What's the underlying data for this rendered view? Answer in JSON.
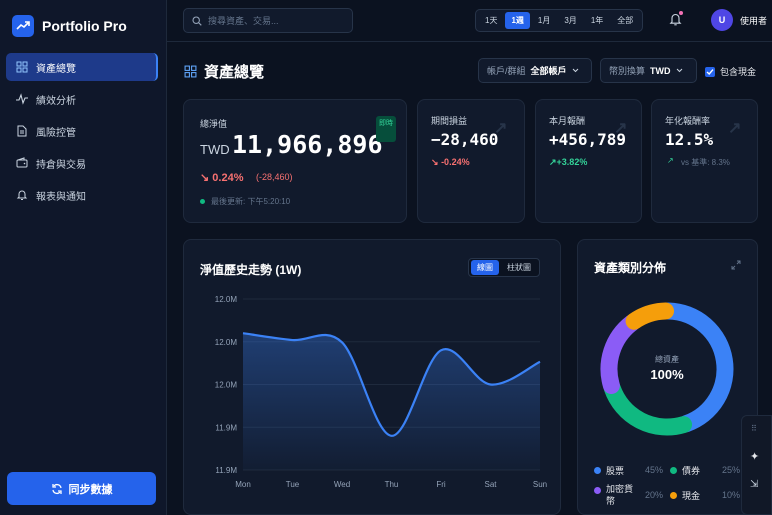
{
  "app": {
    "name": "Portfolio Pro"
  },
  "sidebar": {
    "items": [
      {
        "label": "資產總覽"
      },
      {
        "label": "績效分析"
      },
      {
        "label": "風險控管"
      },
      {
        "label": "持倉與交易"
      },
      {
        "label": "報表與通知"
      }
    ],
    "sync_label": "同步數據"
  },
  "topbar": {
    "search_placeholder": "搜尋資產、交易...",
    "ranges": [
      "1天",
      "1週",
      "1月",
      "3月",
      "1年",
      "全部"
    ],
    "active_range": "1週",
    "user_initial": "U",
    "user_name": "使用者"
  },
  "page": {
    "title": "資產總覽",
    "account_filter": {
      "label": "帳戶/群組",
      "value": "全部帳戶"
    },
    "currency_filter": {
      "label": "幣別換算",
      "value": "TWD"
    },
    "include_cash_label": "包含現金",
    "include_cash": true
  },
  "summary": {
    "label": "總淨值",
    "currency": "TWD",
    "value": "11,966,896",
    "badge": "即時",
    "change_pct": "0.24%",
    "change_abs": "(-28,460)",
    "updated": "最後更新: 下午5:20:10"
  },
  "kpis": [
    {
      "label": "期間損益",
      "value": "−28,460",
      "sub": "-0.24%",
      "sub_icon": "↘"
    },
    {
      "label": "本月報酬",
      "value": "+456,789",
      "sub": "+3.82%",
      "sub_icon": "↗"
    },
    {
      "label": "年化報酬率",
      "value": "12.5%",
      "sub": "vs 基準: 8.3%",
      "sub_icon": "↗"
    }
  ],
  "history": {
    "title": "淨值歷史走勢 (1W)",
    "toggle": [
      "線圖",
      "柱狀圖"
    ],
    "active_toggle": "線圖"
  },
  "allocation": {
    "title": "資產類別分佈",
    "center_label": "總資產",
    "center_value": "100%",
    "items": [
      {
        "name": "股票",
        "pct": "45%",
        "color": "#3b82f6"
      },
      {
        "name": "債券",
        "pct": "25%",
        "color": "#10b981"
      },
      {
        "name": "加密貨幣",
        "pct": "20%",
        "color": "#8b5cf6"
      },
      {
        "name": "現金",
        "pct": "10%",
        "color": "#f59e0b"
      }
    ]
  },
  "chart_data": [
    {
      "type": "area",
      "title": "淨值歷史走勢 (1W)",
      "categories": [
        "Mon",
        "Tue",
        "Wed",
        "Thu",
        "Fri",
        "Sat",
        "Sun"
      ],
      "y_tick_labels": [
        "12.0M",
        "12.0M",
        "12.0M",
        "11.9M",
        "11.9M"
      ],
      "values": [
        12.0,
        11.994,
        11.992,
        11.91,
        11.985,
        11.955,
        11.975
      ],
      "ylim": [
        11.88,
        12.03
      ],
      "grid": true,
      "color": "#3b82f6"
    },
    {
      "type": "pie",
      "title": "資產類別分佈",
      "categories": [
        "股票",
        "債券",
        "加密貨幣",
        "現金"
      ],
      "values": [
        45,
        25,
        20,
        10
      ],
      "colors": [
        "#3b82f6",
        "#10b981",
        "#8b5cf6",
        "#f59e0b"
      ]
    }
  ]
}
